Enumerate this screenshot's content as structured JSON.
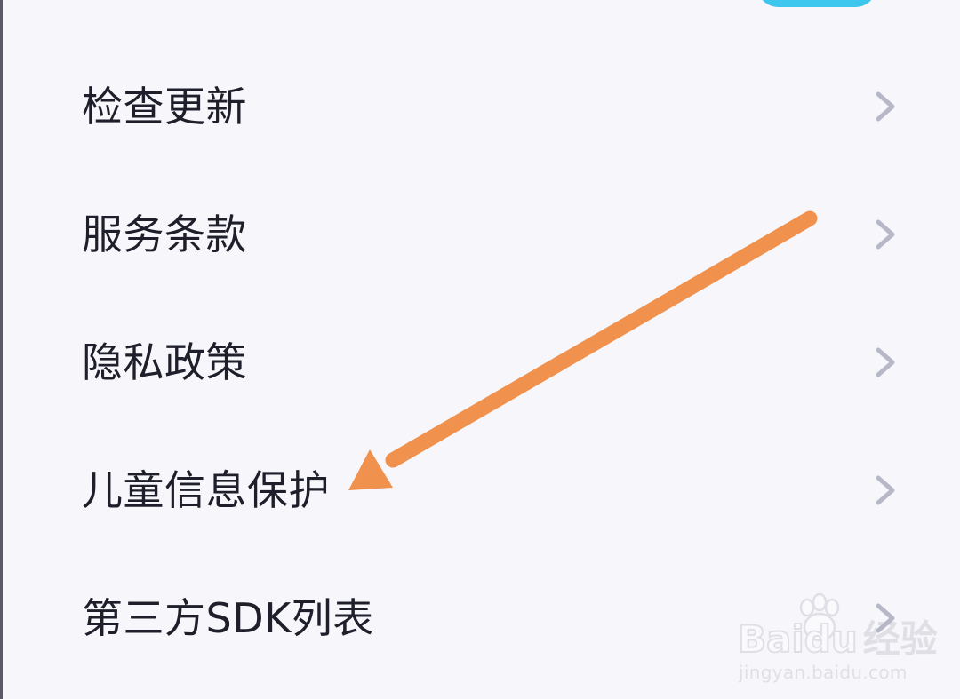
{
  "menu": {
    "items": [
      {
        "label": "检查更新",
        "icon": "chevron-right-icon"
      },
      {
        "label": "服务条款",
        "icon": "chevron-right-icon"
      },
      {
        "label": "隐私政策",
        "icon": "chevron-right-icon"
      },
      {
        "label": "儿童信息保护",
        "icon": "chevron-right-icon"
      },
      {
        "label": "第三方SDK列表",
        "icon": "chevron-right-icon"
      }
    ]
  },
  "annotation": {
    "icon": "orange-arrow-icon",
    "color": "#f0924e"
  },
  "watermark": {
    "brand": "Bai",
    "brand_mid": "du",
    "brand_cn": "经验",
    "url": "jingyan.baidu.com",
    "icon": "paw-icon"
  },
  "colors": {
    "background": "#f7f7fb",
    "label_text": "#1f1f2b",
    "chevron": "#b7b8c7",
    "accent_button": "#3ec7ee"
  }
}
